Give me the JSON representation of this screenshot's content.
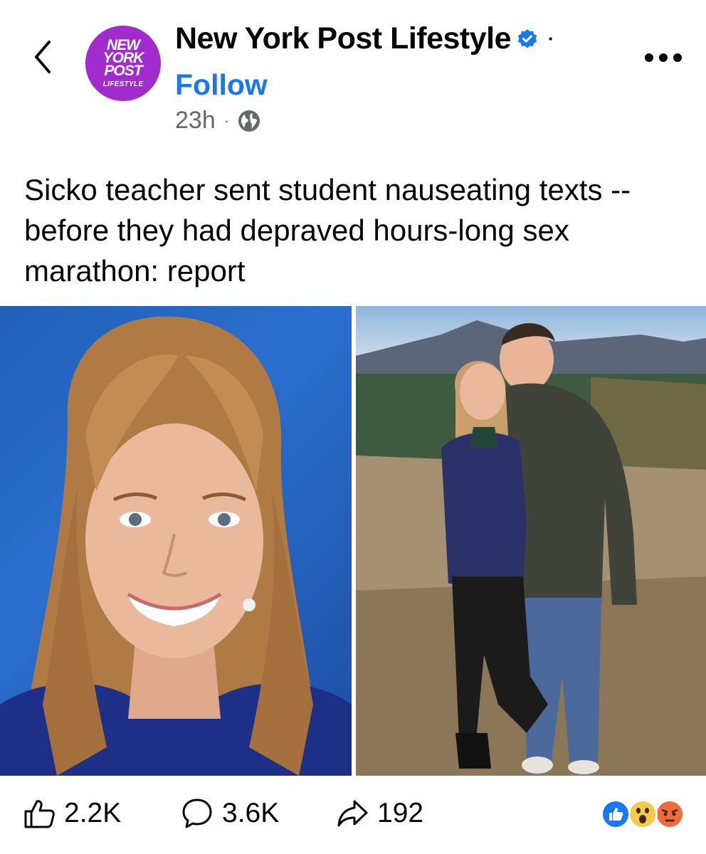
{
  "header": {
    "page_name": "New York Post Lifestyle",
    "follow_label": "Follow",
    "time": "23h",
    "separator": "·",
    "avatar": {
      "line1": "NEW\nYORK\nPOST",
      "line2": "LIFESTYLE"
    },
    "icons": {
      "back": "back-chevron-icon",
      "verified": "verified-badge-icon",
      "audience": "globe-icon",
      "more": "more-options-icon"
    }
  },
  "post": {
    "text": "Sicko teacher sent student nauseating texts -- before they had depraved hours-long sex marathon: report"
  },
  "footer": {
    "likes": "2.2K",
    "comments": "3.6K",
    "shares": "192",
    "reactions": [
      "like",
      "wow",
      "angry"
    ]
  },
  "colors": {
    "brand_blue": "#1877f2",
    "nyp_purple": "#a12bcd",
    "text": "#050505",
    "secondary": "#65676b"
  }
}
